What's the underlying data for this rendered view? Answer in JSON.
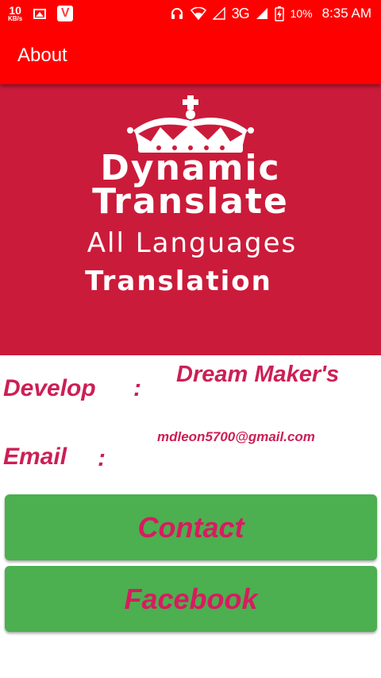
{
  "status_bar": {
    "speed_value": "10",
    "speed_unit": "KB/s",
    "network": "3G",
    "battery_percent": "10%",
    "time": "8:35 AM",
    "icons": [
      "gallery-icon",
      "v-app-icon",
      "headset-icon",
      "wifi-icon",
      "signal-icon",
      "battery-charging-icon"
    ]
  },
  "app_bar": {
    "title": "About"
  },
  "banner": {
    "line1": "Dynamic",
    "line2": "Translate",
    "line3": "All Languages",
    "line4": "Translation",
    "logo_icon": "crown-icon"
  },
  "info": {
    "develop_label": "Develop",
    "develop_colon": ":",
    "develop_value": "Dream Maker's",
    "email_label": "Email",
    "email_colon": ":",
    "email_value": "mdleon5700@gmail.com"
  },
  "buttons": {
    "contact": "Contact",
    "facebook": "Facebook"
  },
  "colors": {
    "app_bar": "#ff0000",
    "banner": "#cb1b3a",
    "accent_text": "#cc1f56",
    "button_bg": "#4caf50"
  }
}
